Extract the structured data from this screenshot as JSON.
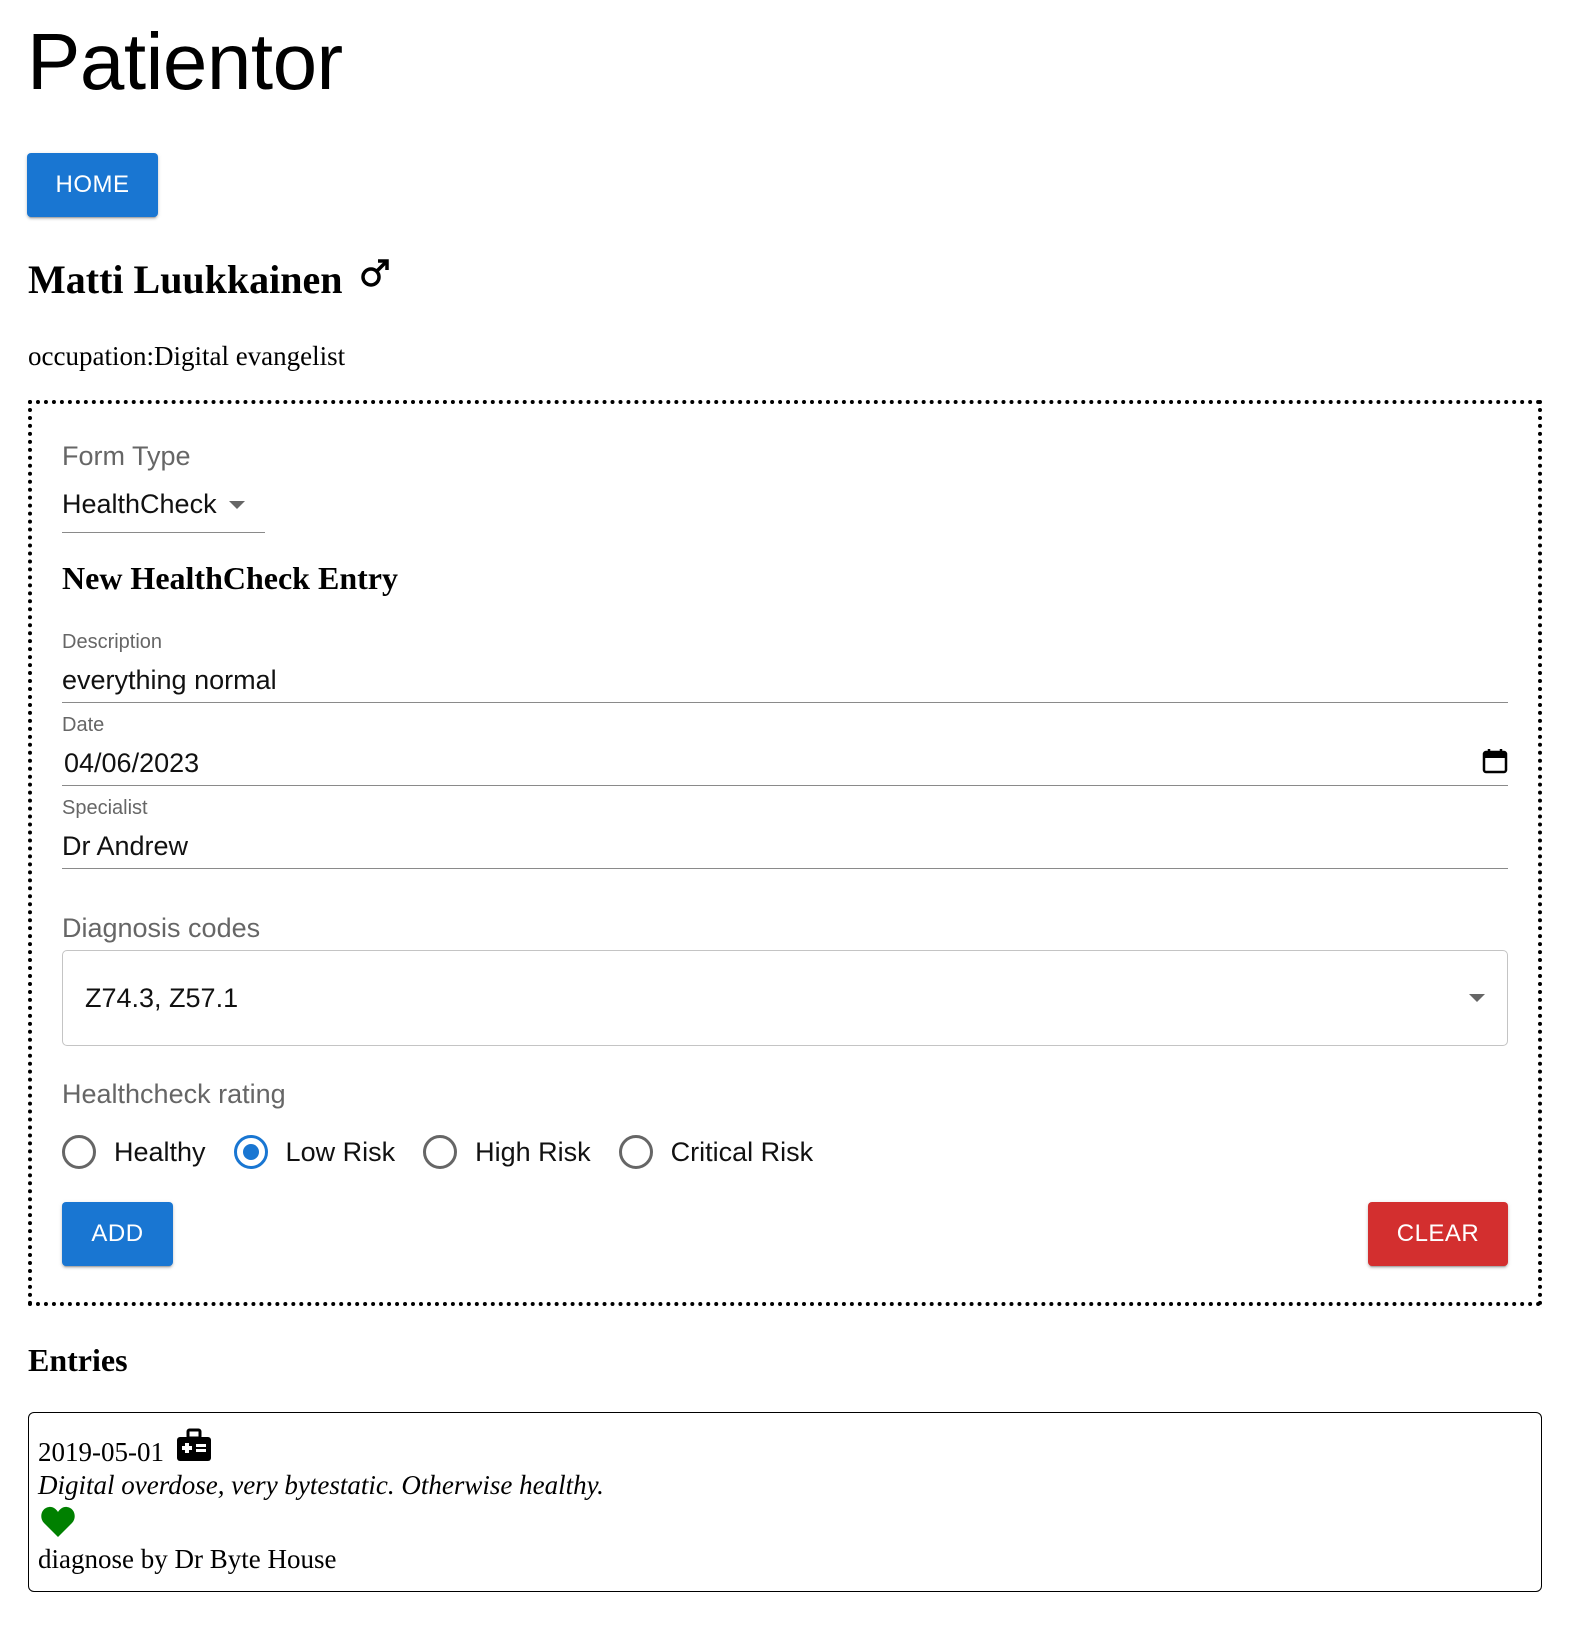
{
  "app": {
    "title": "Patientor"
  },
  "nav": {
    "home_label": "HOME"
  },
  "patient": {
    "name": "Matti Luukkainen",
    "gender_icon": "male-icon",
    "occupation": "occupation:Digital evangelist"
  },
  "form": {
    "form_type_label": "Form Type",
    "form_type_value": "HealthCheck",
    "title": "New HealthCheck Entry",
    "description": {
      "label": "Description",
      "value": "everything normal"
    },
    "date": {
      "label": "Date",
      "value": "04/06/2023"
    },
    "specialist": {
      "label": "Specialist",
      "value": "Dr Andrew"
    },
    "diagnosis_codes": {
      "label": "Diagnosis codes",
      "value": "Z74.3, Z57.1"
    },
    "rating": {
      "label": "Healthcheck rating",
      "options": [
        "Healthy",
        "Low Risk",
        "High Risk",
        "Critical Risk"
      ],
      "selected": "Low Risk"
    },
    "add_label": "ADD",
    "clear_label": "CLEAR"
  },
  "entries": {
    "title": "Entries",
    "items": [
      {
        "date": "2019-05-01",
        "type_icon": "medkit-icon",
        "description": "Digital overdose, very bytestatic. Otherwise healthy.",
        "rating_icon": "heart-icon",
        "rating_color": "#008000",
        "specialist": "diagnose by Dr Byte House"
      }
    ]
  },
  "colors": {
    "primary": "#1976d2",
    "danger": "#d32f2f"
  }
}
